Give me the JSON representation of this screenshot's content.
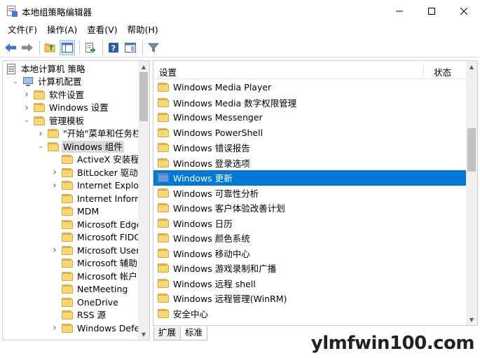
{
  "window": {
    "title": "本地组策略编辑器"
  },
  "menu": [
    {
      "label": "文件(F)"
    },
    {
      "label": "操作(A)"
    },
    {
      "label": "查看(V)"
    },
    {
      "label": "帮助(H)"
    }
  ],
  "tree": {
    "items": [
      {
        "label": "本地计算机 策略",
        "level": 0,
        "expanded": true,
        "icon": "policy-icon"
      },
      {
        "label": "计算机配置",
        "level": 1,
        "expanded": true,
        "icon": "computer-icon"
      },
      {
        "label": "软件设置",
        "level": 2,
        "expander": "collapsed",
        "icon": "folder-icon"
      },
      {
        "label": "Windows 设置",
        "level": 2,
        "expander": "collapsed",
        "icon": "folder-icon"
      },
      {
        "label": "管理模板",
        "level": 2,
        "expander": "expanded",
        "icon": "folder-icon"
      },
      {
        "label": "\"开始\"菜单和任务栏",
        "level": 3,
        "expander": "collapsed",
        "icon": "folder-icon"
      },
      {
        "label": "Windows 组件",
        "level": 3,
        "expander": "expanded",
        "icon": "folder-icon",
        "selected": true
      },
      {
        "label": "ActiveX 安装程序",
        "level": 4,
        "expander": "none",
        "icon": "folder-icon"
      },
      {
        "label": "BitLocker 驱动器",
        "level": 4,
        "expander": "collapsed",
        "icon": "folder-icon"
      },
      {
        "label": "Internet Explorer",
        "level": 4,
        "expander": "collapsed",
        "icon": "folder-icon"
      },
      {
        "label": "Internet Informa",
        "level": 4,
        "expander": "none",
        "icon": "folder-icon"
      },
      {
        "label": "MDM",
        "level": 4,
        "expander": "none",
        "icon": "folder-icon"
      },
      {
        "label": "Microsoft Edge",
        "level": 4,
        "expander": "none",
        "icon": "folder-icon"
      },
      {
        "label": "Microsoft FIDO 身",
        "level": 4,
        "expander": "none",
        "icon": "folder-icon"
      },
      {
        "label": "Microsoft User E",
        "level": 4,
        "expander": "collapsed",
        "icon": "folder-icon"
      },
      {
        "label": "Microsoft 辅助身",
        "level": 4,
        "expander": "none",
        "icon": "folder-icon"
      },
      {
        "label": "Microsoft 帐户",
        "level": 4,
        "expander": "none",
        "icon": "folder-icon"
      },
      {
        "label": "NetMeeting",
        "level": 4,
        "expander": "none",
        "icon": "folder-icon"
      },
      {
        "label": "OneDrive",
        "level": 4,
        "expander": "none",
        "icon": "folder-icon"
      },
      {
        "label": "RSS 源",
        "level": 4,
        "expander": "none",
        "icon": "folder-icon"
      },
      {
        "label": "Windows Defen",
        "level": 4,
        "expander": "collapsed",
        "icon": "folder-icon"
      }
    ]
  },
  "list": {
    "columns": [
      "设置",
      "状态"
    ],
    "items": [
      {
        "label": "Windows Media Player"
      },
      {
        "label": "Windows Media 数字权限管理"
      },
      {
        "label": "Windows Messenger"
      },
      {
        "label": "Windows PowerShell"
      },
      {
        "label": "Windows 错误报告"
      },
      {
        "label": "Windows 登录选项"
      },
      {
        "label": "Windows 更新",
        "selected": true
      },
      {
        "label": "Windows 可靠性分析"
      },
      {
        "label": "Windows 客户体验改善计划"
      },
      {
        "label": "Windows 日历"
      },
      {
        "label": "Windows 颜色系统"
      },
      {
        "label": "Windows 移动中心"
      },
      {
        "label": "Windows 游戏录制和广播"
      },
      {
        "label": "Windows 远程 shell"
      },
      {
        "label": "Windows 远程管理(WinRM)"
      },
      {
        "label": "安全中心"
      }
    ]
  },
  "tabs": [
    {
      "label": "扩展",
      "active": false
    },
    {
      "label": "标准",
      "active": true
    }
  ],
  "watermark": "ylmfwin100.com",
  "colors": {
    "selection": "#0078d7",
    "folder": "#f8d775",
    "tree_selection": "#d9d9d9"
  }
}
